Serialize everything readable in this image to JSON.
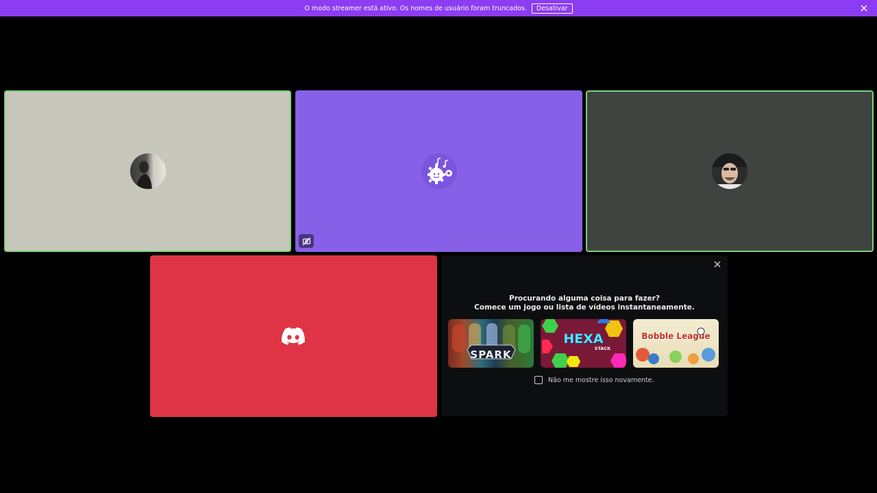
{
  "banner": {
    "message": "O modo streamer está ativo. Os nomes de usuário foram truncados.",
    "button_label": "Desativar",
    "background": "#8c3cf2"
  },
  "tiles": [
    {
      "id": "user-1",
      "background": "#c8c7bb",
      "speaking": true,
      "avatar": "portrait-avatar"
    },
    {
      "id": "bot",
      "background": "#8660e6",
      "speaking": false,
      "avatar": "music-bot-avatar",
      "badge": "camera-off-icon"
    },
    {
      "id": "user-2",
      "background": "#404441",
      "speaking": true,
      "avatar": "selfie-avatar"
    },
    {
      "id": "user-3",
      "background": "#de3446",
      "speaking": false,
      "avatar": "discord-logo-icon"
    }
  ],
  "activity_panel": {
    "title_line1": "Procurando alguma coisa para fazer?",
    "title_line2": "Comece um jogo ou lista de vídeos instantaneamente.",
    "cards": [
      {
        "title": "SPARK"
      },
      {
        "title": "HEXA",
        "subtitle": "STACK"
      },
      {
        "title": "Bobble League"
      }
    ],
    "checkbox_label": "Não me mostre isso novamente.",
    "checked": false
  }
}
